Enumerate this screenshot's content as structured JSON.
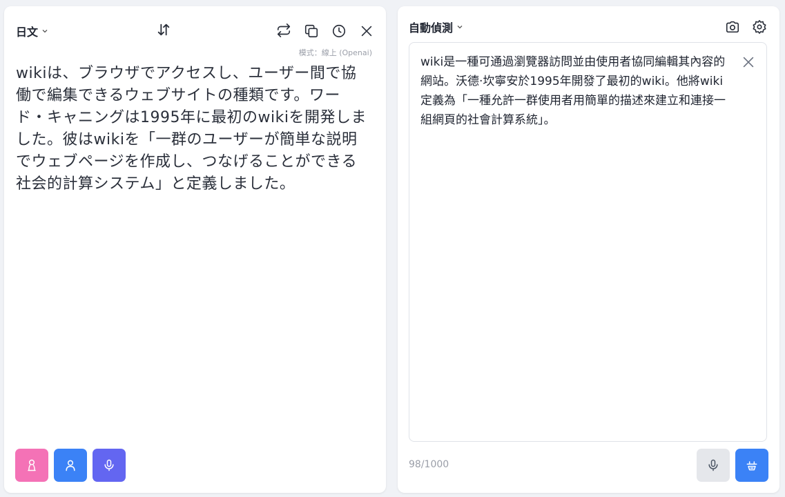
{
  "source": {
    "language": "日文",
    "mode_label": "模式：線上 (Openai)",
    "text": "wikiは、ブラウザでアクセスし、ユーザー間で協働で編集できるウェブサイトの種類です。ワード・キャニングは1995年に最初のwikiを開発しました。彼はwikiを「一群のユーザーが簡単な説明でウェブページを作成し、つなげることができる社会的計算システム」と定義しました。"
  },
  "target": {
    "language": "自動偵測",
    "text": "wiki是一種可通過瀏覽器訪問並由使用者協同編輯其內容的網站。沃德·坎寧安於1995年開發了最初的wiki。他將wiki定義為「一種允許一群使用者用簡單的描述來建立和連接一組網頁的社會計算系統」。",
    "char_count": "98/1000"
  },
  "icons": {
    "swap": "swap-languages-icon",
    "repeat": "repeat-icon",
    "copy": "copy-icon",
    "history": "history-icon",
    "close": "close-icon",
    "camera": "camera-icon",
    "settings": "gear-icon",
    "female_voice": "female-voice-icon",
    "male_voice": "male-voice-icon",
    "mic": "microphone-icon",
    "translate": "translate-icon"
  },
  "colors": {
    "pink_button": "#f472b6",
    "blue_button": "#3b82f6",
    "purple_button": "#6366f1",
    "grey_button": "#e5e7eb",
    "translate_button": "#3b82f6"
  }
}
